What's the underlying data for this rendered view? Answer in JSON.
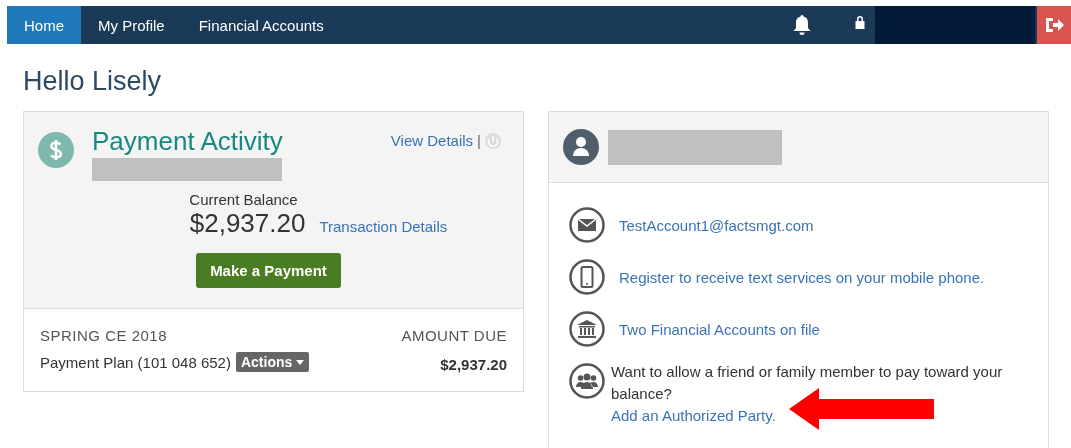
{
  "nav": {
    "tabs": [
      {
        "label": "Home",
        "selected": true
      },
      {
        "label": "My Profile",
        "selected": false
      },
      {
        "label": "Financial Accounts",
        "selected": false
      }
    ]
  },
  "greeting": "Hello Lisely",
  "payment": {
    "title": "Payment Activity",
    "view_details": "View Details",
    "separator": "|",
    "balance_label": "Current Balance",
    "balance": "$2,937.20",
    "transaction_link": "Transaction Details",
    "pay_button": "Make a Payment",
    "term": "SPRING CE 2018",
    "plan": "Payment Plan (101 048 652)",
    "actions": "Actions",
    "amount_label": "AMOUNT DUE",
    "amount": "$2,937.20"
  },
  "contact": {
    "items": [
      {
        "kind": "email",
        "link": "TestAccount1@factsmgt.com"
      },
      {
        "kind": "phone",
        "link": "Register to receive text services on your mobile phone."
      },
      {
        "kind": "bank",
        "link": "Two Financial Accounts on file"
      },
      {
        "kind": "group",
        "text": "Want to allow a friend or family member to pay toward your balance?",
        "link": "Add an Authorized Party."
      }
    ]
  }
}
